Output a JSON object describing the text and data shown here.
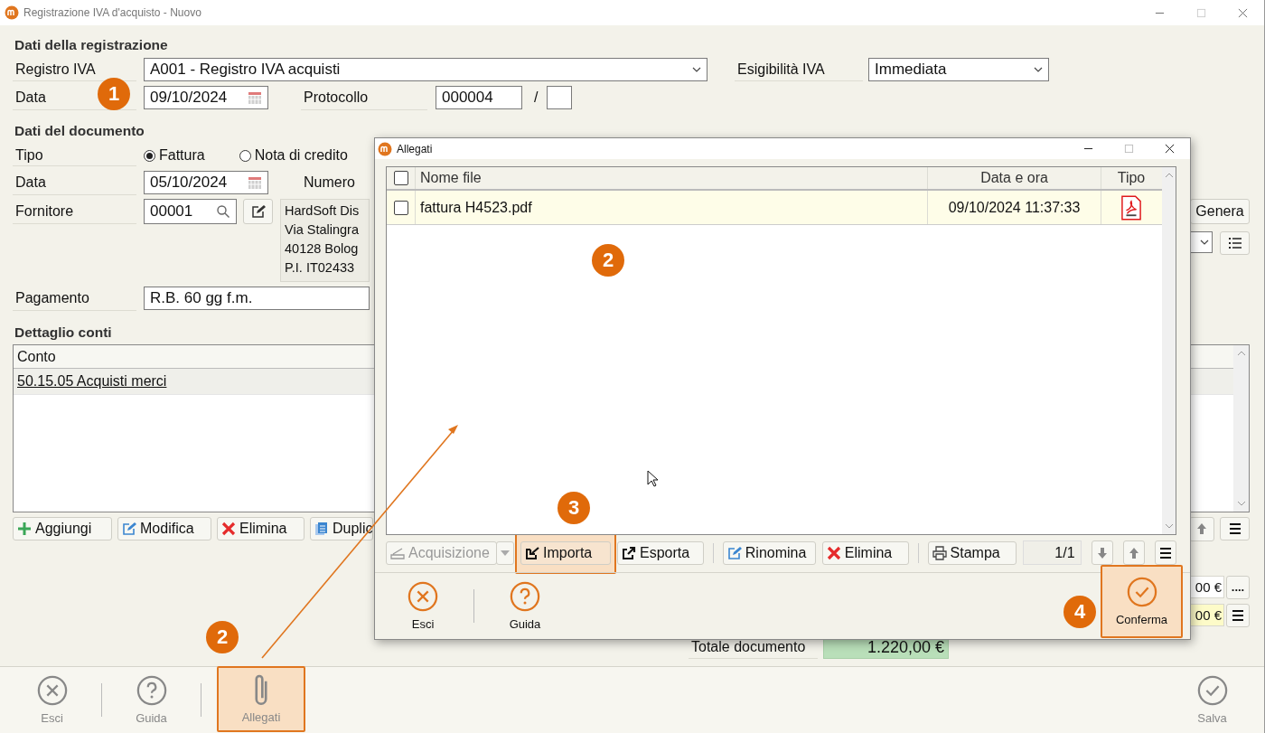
{
  "window": {
    "title": "Registrazione IVA d'acquisto - Nuovo"
  },
  "registration": {
    "heading": "Dati della registrazione",
    "registro_label": "Registro IVA",
    "registro_value": "A001 - Registro IVA acquisti",
    "esigibilita_label": "Esigibilità IVA",
    "esigibilita_value": "Immediata",
    "data_label": "Data",
    "data_value": "09/10/2024",
    "protocollo_label": "Protocollo",
    "protocollo_value": "000004",
    "protocollo_sep": "/"
  },
  "document": {
    "heading": "Dati del documento",
    "tipo_label": "Tipo",
    "tipo_options": [
      {
        "label": "Fattura",
        "selected": true
      },
      {
        "label": "Nota di credito",
        "selected": false
      }
    ],
    "data_label": "Data",
    "data_value": "05/10/2024",
    "numero_label": "Numero",
    "fornitore_label": "Fornitore",
    "fornitore_value": "00001",
    "fornitore_address": [
      "HardSoft Dis",
      "Via Stalingra",
      "40128 Bolog",
      "P.I. IT02433"
    ],
    "genera_button": "Genera",
    "pagamento_label": "Pagamento",
    "pagamento_value": "R.B. 60 gg f.m."
  },
  "accounts": {
    "heading": "Dettaglio conti",
    "columns": [
      "Conto"
    ],
    "rows": [
      {
        "conto": "50.15.05 Acquisti merci",
        "selected": true
      }
    ],
    "toolbar": [
      {
        "kind": "add",
        "label": "Aggiungi"
      },
      {
        "kind": "edit",
        "label": "Modifica"
      },
      {
        "kind": "delete",
        "label": "Elimina"
      },
      {
        "kind": "copy",
        "label": "Duplic"
      }
    ]
  },
  "totals": {
    "rows": [
      {
        "kind": "plain",
        "value": "00 €",
        "button": "...."
      },
      {
        "kind": "accent",
        "value": "00 €"
      }
    ],
    "total_label": "Totale documento",
    "total_value": "1.220,00 €"
  },
  "footer": [
    {
      "kind": "exit",
      "label": "Esci",
      "disabled": true,
      "highlighted": false
    },
    {
      "kind": "help",
      "label": "Guida",
      "disabled": true,
      "highlighted": false
    },
    {
      "kind": "attach",
      "label": "Allegati",
      "disabled": true,
      "highlighted": true
    },
    {
      "kind": "save",
      "label": "Salva",
      "disabled": true,
      "highlighted": false
    }
  ],
  "dialog": {
    "title": "Allegati",
    "columns": [
      "Nome file",
      "Data e ora",
      "Tipo"
    ],
    "select_all_checked": false,
    "files": [
      {
        "checked": false,
        "selected": true,
        "name": "fattura H4523.pdf",
        "date": "09/10/2024 11:37:33",
        "kind": "pdf"
      }
    ],
    "toolbar": [
      {
        "kind": "scan",
        "label": "Acquisizione",
        "disabled": true,
        "highlighted": false
      },
      {
        "kind": "import",
        "label": "Importa",
        "disabled": false,
        "highlighted": true
      },
      {
        "kind": "export",
        "label": "Esporta",
        "disabled": false,
        "highlighted": false
      },
      {
        "kind": "edit",
        "label": "Rinomina",
        "disabled": false,
        "highlighted": false
      },
      {
        "kind": "delete",
        "label": "Elimina",
        "disabled": false,
        "highlighted": false
      },
      {
        "kind": "print",
        "label": "Stampa",
        "disabled": false,
        "highlighted": false
      }
    ],
    "page": "1/1",
    "footer": [
      {
        "kind": "exit",
        "label": "Esci",
        "disabled": false,
        "highlighted": false
      },
      {
        "kind": "help",
        "label": "Guida",
        "disabled": false,
        "highlighted": false
      },
      {
        "kind": "save",
        "label": "Conferma",
        "disabled": false,
        "highlighted": true
      }
    ]
  },
  "annotations": [
    {
      "label": "1"
    },
    {
      "label": "2"
    },
    {
      "label": "2"
    },
    {
      "label": "3"
    },
    {
      "label": "4"
    }
  ]
}
